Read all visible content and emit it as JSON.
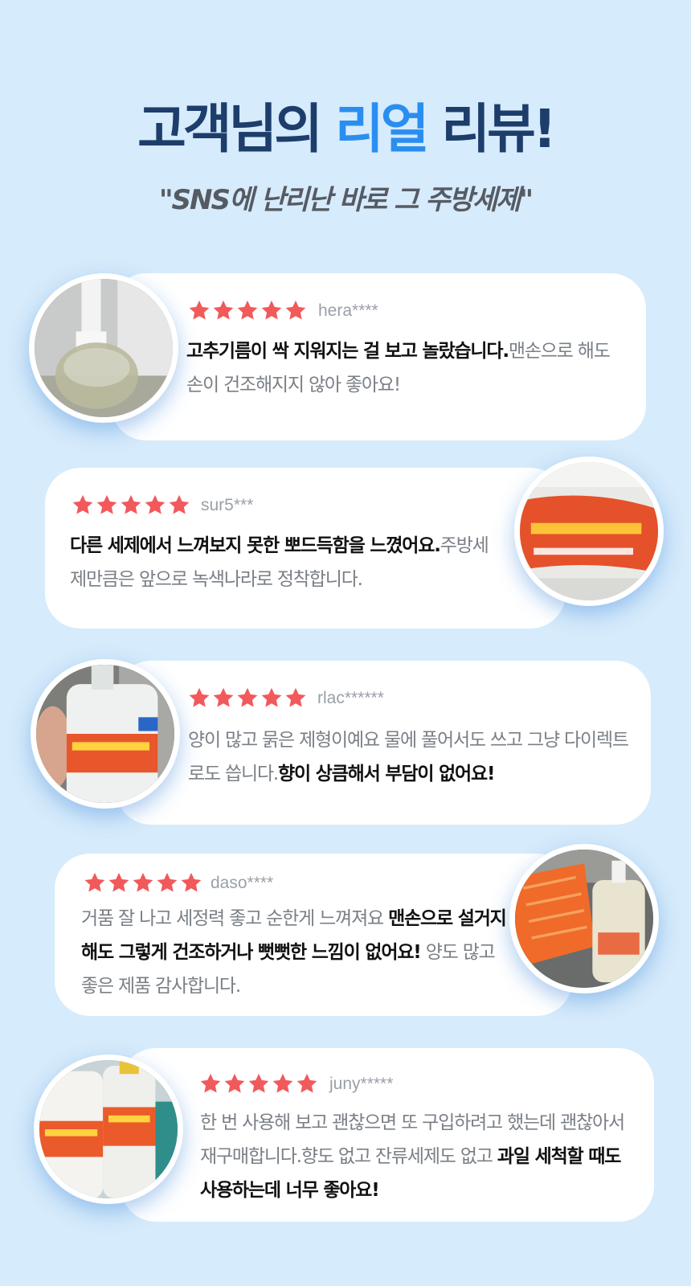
{
  "header": {
    "title_part1": "고객님의",
    "title_accent": "리얼",
    "title_part2": "리뷰!",
    "subtitle": "\"SNS에 난리난 바로 그 주방세제\""
  },
  "colors": {
    "background": "#d6ebfb",
    "title": "#1d3d6b",
    "accent": "#2a8ef0",
    "star": "#f2595b"
  },
  "reviews": [
    {
      "rating": 5,
      "user": "hera****",
      "segments": [
        {
          "text": "고추기름이 싹 지워지는 걸 보고 놀랐습니다.",
          "bold": true
        },
        {
          "text": "맨손으로 해도 손이 건조해지지 않아 좋아요!",
          "bold": false
        }
      ],
      "photo_icon": "dispenser-pump-photo"
    },
    {
      "rating": 5,
      "user": "sur5***",
      "segments": [
        {
          "text": "다른 세제에서 느껴보지 못한 뽀드득함을 느꼈어요.",
          "bold": true
        },
        {
          "text": "주방세제만큼은 앞으로 녹색나라로 정착합니다.",
          "bold": false
        }
      ],
      "photo_icon": "bottle-label-photo"
    },
    {
      "rating": 5,
      "user": "rlac******",
      "segments": [
        {
          "text": "양이 많고 묽은 제형이예요 물에 풀어서도 쓰고 그냥 다이렉트로도 씁니다.",
          "bold": false
        },
        {
          "text": "향이 상큼해서 부담이 없어요!",
          "bold": true
        }
      ],
      "photo_icon": "hand-bottle-photo"
    },
    {
      "rating": 5,
      "user": "daso****",
      "segments": [
        {
          "text": "거품 잘 나고 세정력 좋고 순한게 느껴져요 ",
          "bold": false
        },
        {
          "text": "맨손으로 설거지해도 그렇게 건조하거나 뻣뻣한 느낌이 없어요!",
          "bold": true
        },
        {
          "text": " 양도 많고 좋은 제품 감사합니다.",
          "bold": false
        }
      ],
      "photo_icon": "sink-bottle-photo"
    },
    {
      "rating": 5,
      "user": "juny*****",
      "segments": [
        {
          "text": "한 번 사용해 보고 괜찮으면 또 구입하려고 했는데 괜찮아서 재구매합니다.향도 없고 잔류세제도 없고 ",
          "bold": false
        },
        {
          "text": "과일 세척할 때도 사용하는데 너무 좋아요!",
          "bold": true
        }
      ],
      "photo_icon": "two-bottles-photo"
    }
  ]
}
